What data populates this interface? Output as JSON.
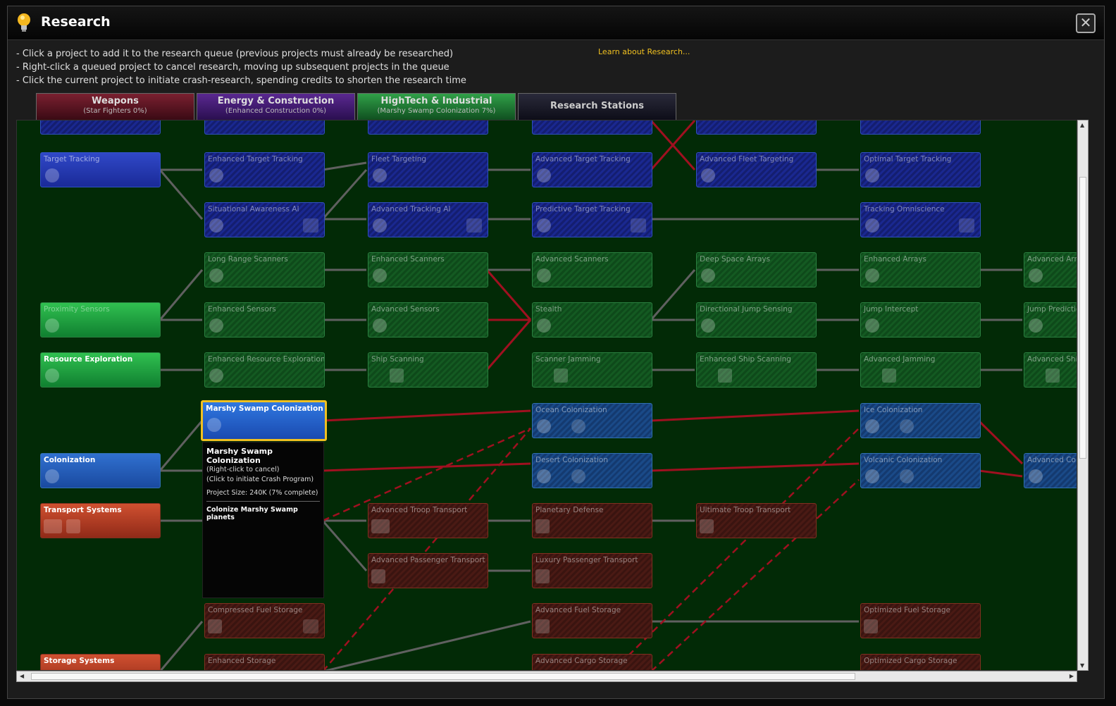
{
  "window": {
    "title": "Research",
    "close_icon": "close-icon"
  },
  "instructions": [
    "- Click a project to add it to the research queue (previous projects must already be researched)",
    "- Right-click a queued project to cancel research, moving up subsequent projects in the queue",
    "- Click the current project to initiate crash-research, spending credits to shorten the research time"
  ],
  "learn_link": "Learn about Research...",
  "tabs": [
    {
      "name": "Weapons",
      "sub": "(Star Fighters 0%)"
    },
    {
      "name": "Energy & Construction",
      "sub": "(Enhanced Construction 0%)"
    },
    {
      "name": "HighTech & Industrial",
      "sub": "(Marshy Swamp Colonization 7%)"
    },
    {
      "name": "Research Stations",
      "sub": ""
    }
  ],
  "nodes": {
    "target_tracking": "Target Tracking",
    "enhanced_target_tracking": "Enhanced Target Tracking",
    "fleet_targeting": "Fleet Targeting",
    "advanced_target_tracking": "Advanced Target Tracking",
    "advanced_fleet_targeting": "Advanced Fleet Targeting",
    "optimal_target_tracking": "Optimal Target Tracking",
    "situational_awareness_ai": "Situational Awareness AI",
    "advanced_tracking_ai": "Advanced Tracking AI",
    "predictive_target_tracking": "Predictive Target Tracking",
    "tracking_omniscience": "Tracking Omniscience",
    "long_range_scanners": "Long Range Scanners",
    "enhanced_scanners": "Enhanced Scanners",
    "advanced_scanners": "Advanced Scanners",
    "deep_space_arrays": "Deep Space Arrays",
    "enhanced_arrays": "Enhanced Arrays",
    "advanced_arrays": "Advanced Arrays",
    "proximity_sensors": "Proximity Sensors",
    "enhanced_sensors": "Enhanced Sensors",
    "advanced_sensors": "Advanced Sensors",
    "stealth": "Stealth",
    "directional_jump_sensing": "Directional Jump Sensing",
    "jump_intercept": "Jump Intercept",
    "jump_prediction": "Jump Prediction",
    "resource_exploration": "Resource Exploration",
    "enhanced_resource_exploration": "Enhanced Resource Exploration",
    "ship_scanning": "Ship Scanning",
    "scanner_jamming": "Scanner Jamming",
    "enhanced_ship_scanning": "Enhanced Ship Scanning",
    "advanced_jamming": "Advanced Jamming",
    "advanced_ship_scanning": "Advanced Ship S",
    "marshy_swamp_colonization": "Marshy Swamp Colonization (1)",
    "ocean_colonization": "Ocean Colonization",
    "ice_colonization": "Ice Colonization",
    "colonization": "Colonization",
    "desert_colonization": "Desert Colonization",
    "volcanic_colonization": "Volcanic Colonization",
    "advanced_colonization": "Advanced Coloni",
    "transport_systems": "Transport Systems",
    "advanced_troop_transport": "Advanced Troop Transport",
    "planetary_defense": "Planetary Defense",
    "ultimate_troop_transport": "Ultimate Troop Transport",
    "advanced_passenger_transport": "Advanced Passenger Transport",
    "luxury_passenger_transport": "Luxury Passenger Transport",
    "compressed_fuel_storage": "Compressed Fuel Storage",
    "advanced_fuel_storage": "Advanced Fuel Storage",
    "optimized_fuel_storage": "Optimized Fuel Storage",
    "storage_systems": "Storage Systems",
    "enhanced_storage": "Enhanced Storage",
    "advanced_cargo_storage": "Advanced Cargo Storage",
    "optimized_cargo_storage": "Optimized Cargo Storage"
  },
  "tooltip": {
    "title": "Marshy Swamp Colonization",
    "line1": "(Right-click to cancel)",
    "line2": "(Click to initiate Crash Program)",
    "size": "Project Size: 240K  (7% complete)",
    "desc": "Colonize Marshy Swamp planets"
  },
  "colors": {
    "tree_bg": "#022a06",
    "queue_highlight": "#f0c020",
    "link_red": "#a01020",
    "link_grey": "#606060"
  }
}
